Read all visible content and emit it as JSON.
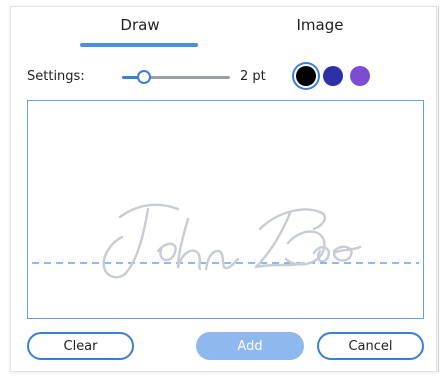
{
  "tabs": [
    {
      "label": "Draw",
      "active": true
    },
    {
      "label": "Image",
      "active": false
    }
  ],
  "settings": {
    "label": "Settings:",
    "stroke_width_value": "2 pt",
    "slider_fraction": 0.2
  },
  "colors": {
    "options": [
      "#000000",
      "#2c2fa6",
      "#7c4dd3"
    ],
    "selected": "#000000",
    "accent": "#4a90e2"
  },
  "canvas": {
    "placeholder_signature": "John Doe"
  },
  "buttons": {
    "clear": "Clear",
    "add": "Add",
    "cancel": "Cancel"
  }
}
